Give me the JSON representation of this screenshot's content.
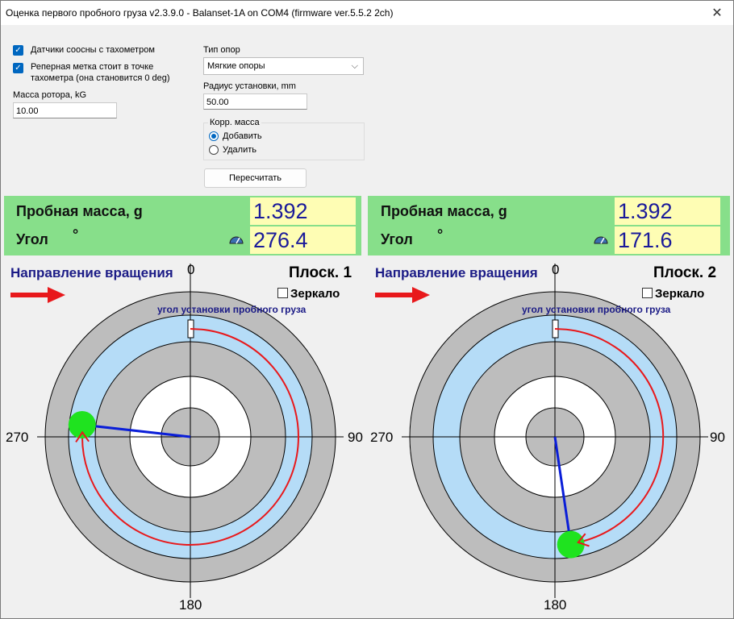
{
  "window": {
    "title": "Оценка первого пробного груза v2.3.9.0 - Balanset-1A on COM4 (firmware ver.5.5.2 2ch)"
  },
  "settings": {
    "cb_coaxial": {
      "label": "Датчики соосны с тахометром",
      "checked": true
    },
    "cb_reflector": {
      "line1": "Реперная метка стоит в точке",
      "line2": "тахометра (она становится 0 deg)",
      "checked": true
    },
    "rotor_mass_label": "Масса ротора, kG",
    "rotor_mass_value": "10.00",
    "support_type_label": "Тип опор",
    "support_type_value": "Мягкие опоры",
    "radius_label": "Радиус установки, mm",
    "radius_value": "50.00",
    "corr_group_label": "Корр. масса",
    "radio_add_label": "Добавить",
    "radio_remove_label": "Удалить",
    "radio_selected": "add",
    "recalc_label": "Пересчитать"
  },
  "planes": [
    {
      "mass_label": "Пробная масса, g",
      "angle_label": "Угол",
      "angle_unit": "°",
      "mass_value": "1.392",
      "angle_value": "276.4",
      "title": "Плоск. 1",
      "rotation_label": "Направление вращения",
      "mirror_label": "Зеркало",
      "mirror_checked": false,
      "install_label": "угол установки пробного  груза",
      "deg_0": "0",
      "deg_90": "90",
      "deg_180": "180",
      "deg_270": "270",
      "angle_deg": 276.4
    },
    {
      "mass_label": "Пробная масса, g",
      "angle_label": "Угол",
      "angle_unit": "°",
      "mass_value": "1.392",
      "angle_value": "171.6",
      "title": "Плоск. 2",
      "rotation_label": "Направление вращения",
      "mirror_label": "Зеркало",
      "mirror_checked": false,
      "install_label": "угол установки пробного  груза",
      "deg_0": "0",
      "deg_90": "90",
      "deg_180": "180",
      "deg_270": "270",
      "angle_deg": 171.6
    }
  ],
  "colors": {
    "panel_green": "#87df8a",
    "value_yellow": "#fefdb4",
    "ring_blue": "#b5dcf7",
    "ring_gray": "#bdbdbd",
    "arrow_red": "#e8181b",
    "vector_blue": "#0a1ed8",
    "weight_green": "#1fe31f"
  }
}
